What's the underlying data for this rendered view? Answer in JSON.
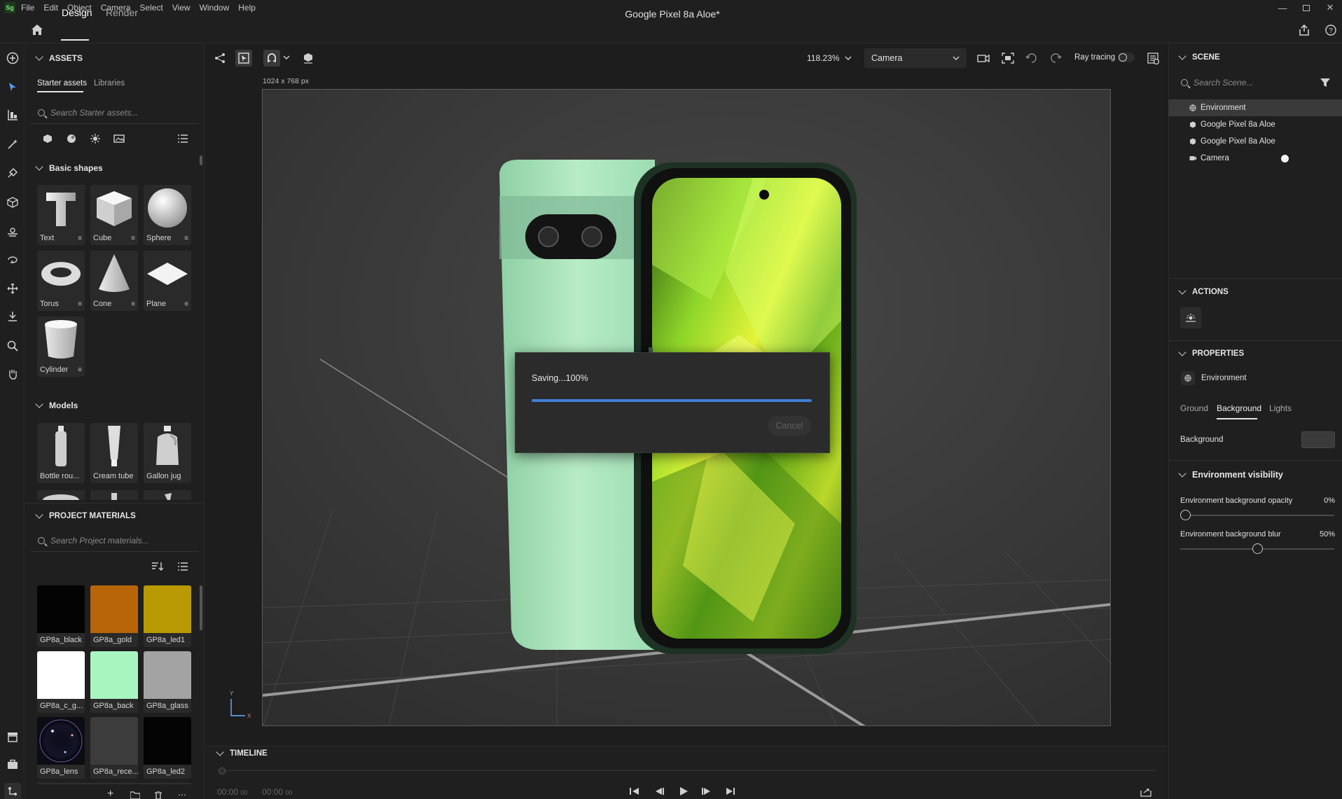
{
  "menu": {
    "logo": "Sg",
    "items": [
      "File",
      "Edit",
      "Object",
      "Camera",
      "Select",
      "View",
      "Window",
      "Help"
    ]
  },
  "header": {
    "tabs": [
      "Design",
      "Render"
    ],
    "title": "Google Pixel 8a Aloe*"
  },
  "canvas_toolbar": {
    "zoom": "118.23%",
    "camera": "Camera",
    "ray_tracing_label": "Ray tracing",
    "canvas_size": "1024 x 768 px"
  },
  "assets": {
    "title": "ASSETS",
    "tabs": [
      "Starter assets",
      "Libraries"
    ],
    "search_placeholder": "Search Starter assets...",
    "basic_shapes_title": "Basic shapes",
    "shapes": [
      "Text",
      "Cube",
      "Sphere",
      "Torus",
      "Cone",
      "Plane",
      "Cylinder"
    ],
    "models_title": "Models",
    "models": [
      "Bottle rou...",
      "Cream tube",
      "Gallon jug"
    ]
  },
  "materials": {
    "title": "PROJECT MATERIALS",
    "search_placeholder": "Search Project materials...",
    "items": [
      {
        "name": "GP8a_black",
        "color": "#030303"
      },
      {
        "name": "GP8a_gold",
        "color": "#b86408"
      },
      {
        "name": "GP8a_led1",
        "color": "#b99a04"
      },
      {
        "name": "GP8a_c_g...",
        "color": "#ffffff"
      },
      {
        "name": "GP8a_back",
        "color": "#a8f5c0"
      },
      {
        "name": "GP8a_glass",
        "color": "#a3a3a3"
      },
      {
        "name": "GP8a_lens",
        "color": "#0c0c14"
      },
      {
        "name": "GP8a_rece...",
        "color": "#3c3c3c"
      },
      {
        "name": "GP8a_led2",
        "color": "#040404"
      }
    ]
  },
  "dialog": {
    "status": "Saving...100%",
    "progress": 1.0,
    "cancel_label": "Cancel"
  },
  "timeline": {
    "title": "TIMELINE",
    "time_current": "00:00",
    "time_current_frames": "00",
    "time_end": "00:00",
    "time_end_frames": "00"
  },
  "scene": {
    "title": "SCENE",
    "search_placeholder": "Search Scene...",
    "items": [
      "Environment",
      "Google Pixel 8a Aloe",
      "Google Pixel 8a Aloe",
      "Camera"
    ]
  },
  "actions": {
    "title": "ACTIONS"
  },
  "properties": {
    "title": "PROPERTIES",
    "object": "Environment",
    "tabs": [
      "Ground",
      "Background",
      "Lights"
    ],
    "background_label": "Background",
    "visibility_title": "Environment visibility",
    "opacity_label": "Environment background opacity",
    "opacity_value": "0%",
    "opacity_level": 0.0,
    "blur_label": "Environment background blur",
    "blur_value": "50%",
    "blur_level": 0.5
  },
  "gizmo": {
    "y": "Y",
    "x": "X"
  },
  "colors": {
    "accent": "#3f7fd6",
    "panel": "#1f1f1f",
    "phone_back": "#a8e6bb"
  }
}
